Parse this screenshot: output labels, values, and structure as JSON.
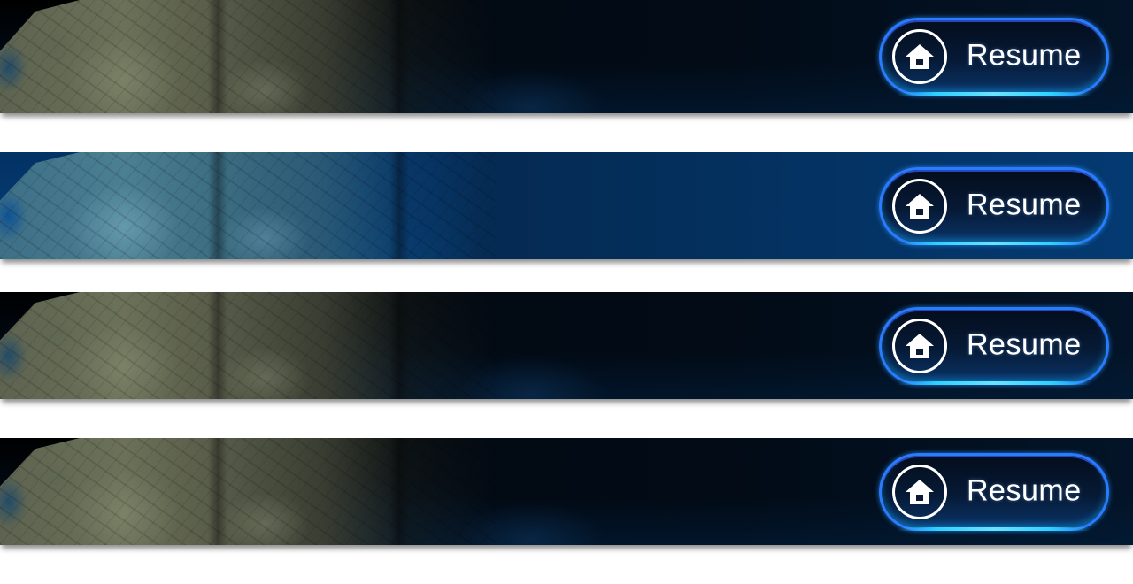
{
  "colors": {
    "button_border": "#2a7cff",
    "button_glow": "#2fd0ff",
    "banner_dark": "#010810",
    "banner_blue": "#04305e",
    "text": "#ffffff"
  },
  "banners": [
    {
      "variant": "dark",
      "button": {
        "label": "Resume",
        "icon": "home-icon"
      }
    },
    {
      "variant": "blue",
      "button": {
        "label": "Resume",
        "icon": "home-icon"
      }
    },
    {
      "variant": "dark",
      "button": {
        "label": "Resume",
        "icon": "home-icon"
      }
    },
    {
      "variant": "dark",
      "button": {
        "label": "Resume",
        "icon": "home-icon"
      }
    }
  ]
}
